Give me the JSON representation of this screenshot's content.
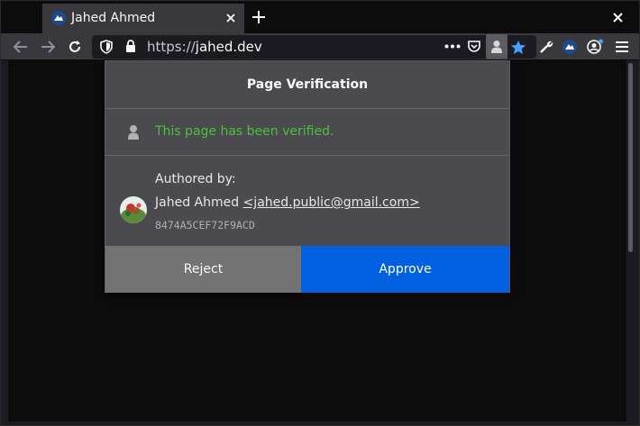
{
  "tab": {
    "title": "Jahed Ahmed",
    "favicon_icon": "jahed-logo-icon"
  },
  "toolbar": {
    "url_scheme": "https://",
    "url_host": "jahed.dev",
    "icons": [
      "back-arrow-icon",
      "forward-arrow-icon",
      "reload-icon",
      "shield-icon",
      "lock-icon",
      "more-actions-icon",
      "pocket-icon",
      "page-verification-extension-icon",
      "bookmark-star-icon",
      "wrench-icon",
      "jahed-extension-icon",
      "account-icon",
      "hamburger-menu-icon"
    ]
  },
  "popup": {
    "title": "Page Verification",
    "status_text": "This page has been verified.",
    "author_label": "Authored by:",
    "author_name": "Jahed Ahmed",
    "author_email": "<jahed.public@gmail.com>",
    "fingerprint": "8474A5CEF72F9ACD",
    "reject_label": "Reject",
    "approve_label": "Approve"
  },
  "colors": {
    "verified_green": "#4ac13b",
    "approve_blue": "#0060df",
    "reject_gray": "#737373",
    "bookmark_blue": "#45a1ff"
  }
}
